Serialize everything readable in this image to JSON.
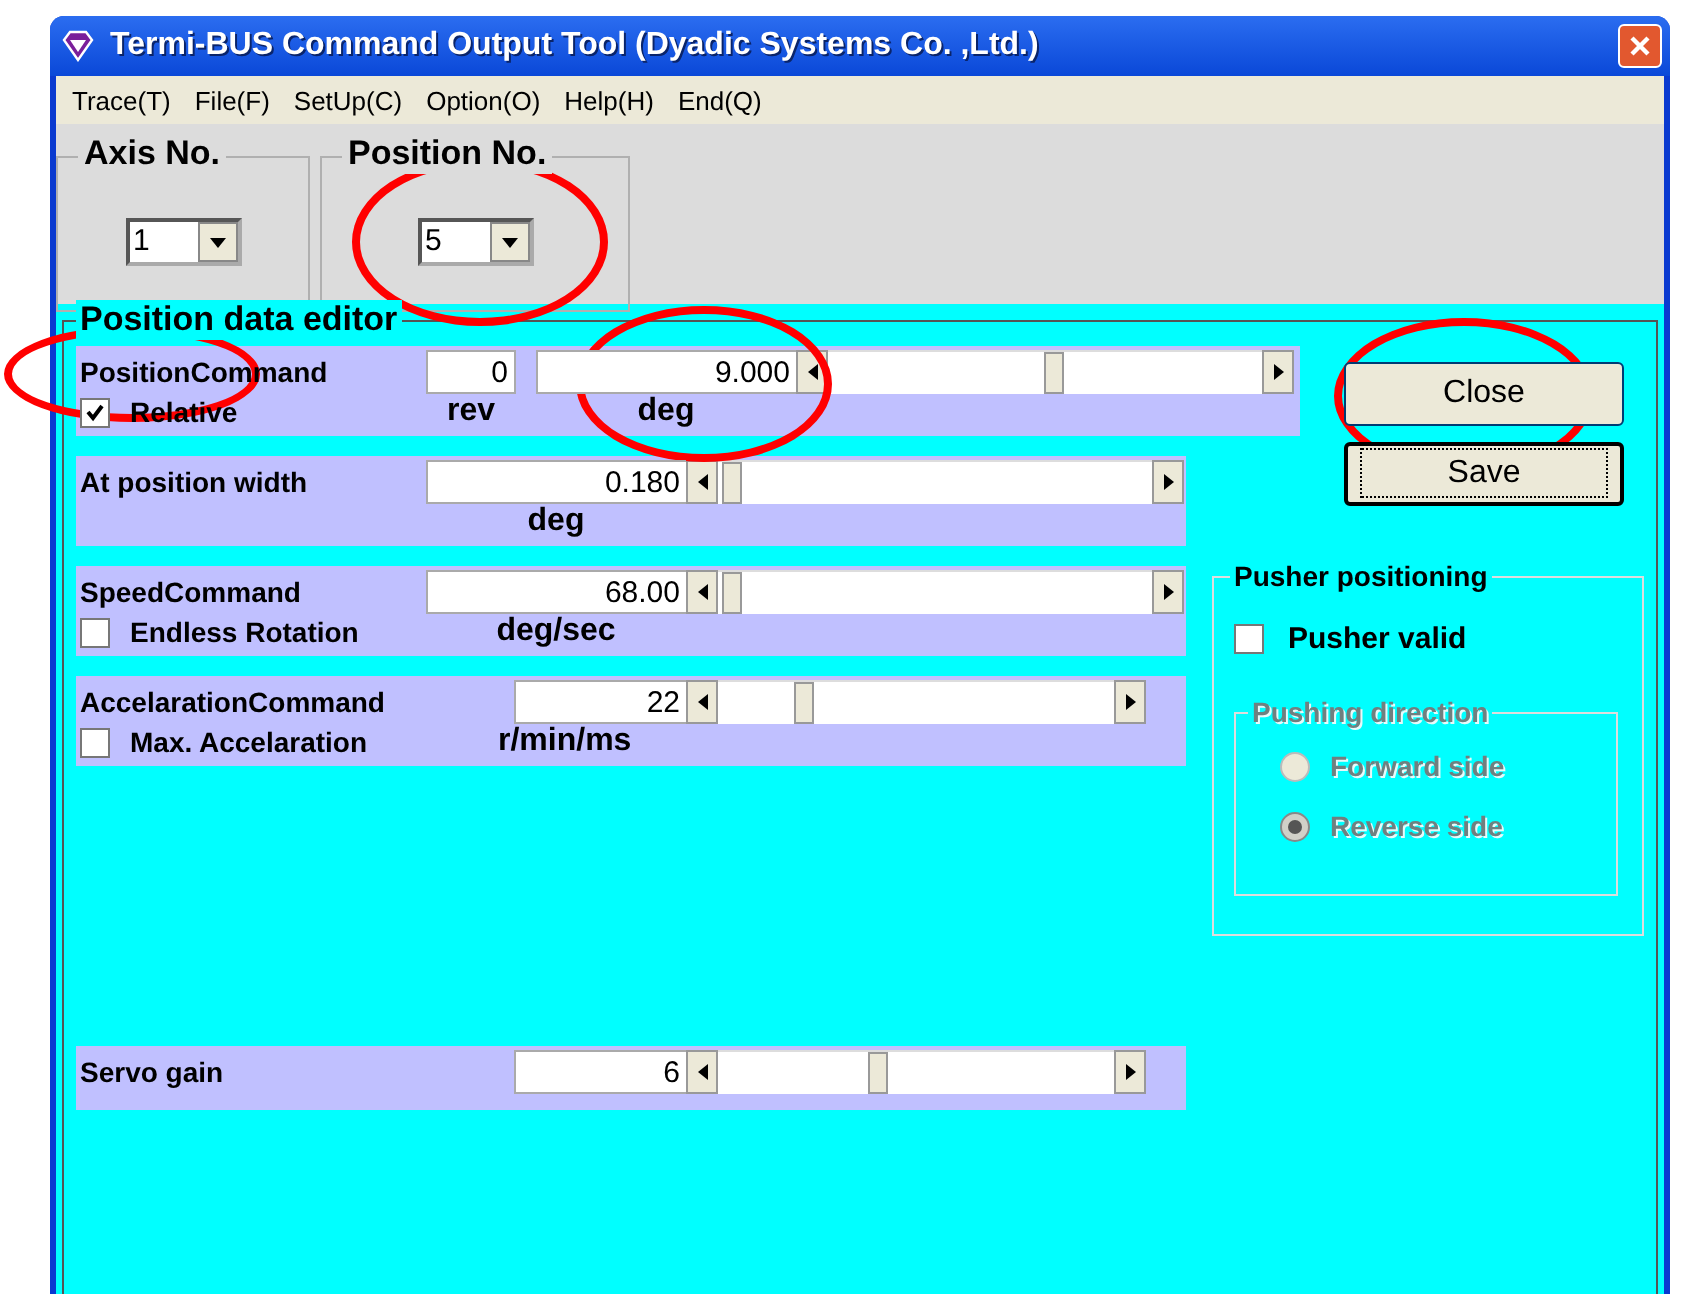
{
  "window": {
    "title": "Termi-BUS Command Output Tool (Dyadic Systems Co. ,Ltd.)"
  },
  "menu": [
    "Trace(T)",
    "File(F)",
    "SetUp(C)",
    "Option(O)",
    "Help(H)",
    "End(Q)"
  ],
  "selectors": [
    {
      "label": "Axis No.",
      "value": "1"
    },
    {
      "label": "Position No.",
      "value": "5",
      "circled": true
    }
  ],
  "editor": {
    "title": "Position data editor",
    "rows": [
      {
        "kind": "wide",
        "label": "PositionCommand",
        "label_circled": true,
        "fields": [
          {
            "value": "0",
            "unit": "rev"
          },
          {
            "value": "9.000",
            "unit": "deg",
            "circled": true
          }
        ],
        "level": 0.52,
        "checkbox": {
          "label": "Relative",
          "checked": true
        }
      },
      {
        "kind": "wide",
        "label": "At position width",
        "fields": [
          {
            "value": "0.180",
            "unit": "deg"
          }
        ],
        "level": 0.01
      },
      {
        "kind": "wide",
        "label": "SpeedCommand",
        "fields": [
          {
            "value": "68.00",
            "unit": "deg/sec"
          }
        ],
        "level": 0.01,
        "checkbox": {
          "label": "Endless Rotation",
          "checked": false
        }
      },
      {
        "kind": "short",
        "label": "AccelarationCommand",
        "fields": [
          {
            "value": "22",
            "unit": "r/min/ms"
          }
        ],
        "level": 0.2,
        "checkbox": {
          "label": "Max. Accelaration",
          "checked": false
        }
      },
      {
        "kind": "short",
        "label": "Servo gain",
        "fields": [
          {
            "value": "6"
          }
        ],
        "level": 0.4
      }
    ]
  },
  "buttons": [
    {
      "label": "Close",
      "circled": true,
      "focused": false
    },
    {
      "label": "Save",
      "focused": true
    }
  ],
  "pusher": {
    "title": "Pusher positioning",
    "checkbox": {
      "label": "Pusher valid",
      "checked": false
    },
    "direction": {
      "title": "Pushing direction",
      "disabled": true,
      "options": [
        {
          "label": "Forward side",
          "selected": false
        },
        {
          "label": "Reverse side",
          "selected": true
        }
      ]
    }
  }
}
